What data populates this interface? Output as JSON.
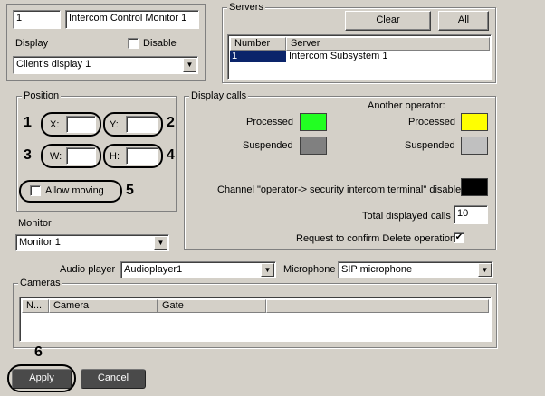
{
  "object": {
    "id": "1",
    "name": "Intercom Control Monitor 1",
    "display_label": "Display",
    "disable_label": "Disable",
    "disable_checked": false,
    "display_value": "Client's display 1"
  },
  "servers": {
    "title": "Servers",
    "clear_label": "Clear",
    "all_label": "All",
    "columns": [
      "Number",
      "Server"
    ],
    "rows": [
      {
        "number": "1",
        "server": "Intercom Subsystem 1"
      }
    ]
  },
  "position": {
    "title": "Position",
    "x_label": "X:",
    "y_label": "Y:",
    "w_label": "W:",
    "h_label": "H:",
    "x_value": "",
    "y_value": "",
    "w_value": "",
    "h_value": "",
    "allow_moving_label": "Allow moving",
    "allow_moving_checked": false
  },
  "annotations": {
    "n1": "1",
    "n2": "2",
    "n3": "3",
    "n4": "4",
    "n5": "5",
    "n6": "6"
  },
  "monitor": {
    "label": "Monitor",
    "value": "Monitor 1"
  },
  "display_calls": {
    "title": "Display calls",
    "another_operator_label": "Another operator:",
    "processed_label": "Processed",
    "suspended_label": "Suspended",
    "processed_color": "#22ff22",
    "suspended_color": "#808080",
    "other_processed_label": "Processed",
    "other_suspended_label": "Suspended",
    "other_processed_color": "#ffff00",
    "other_suspended_color": "#c0c0c0",
    "channel_label": "Channel \"operator-> security intercom terminal\" disabled",
    "channel_color": "#000000",
    "total_label": "Total displayed calls",
    "total_value": "10",
    "confirm_delete_label": "Request to confirm Delete operation",
    "confirm_delete_checked": true
  },
  "audio": {
    "player_label": "Audio player",
    "player_value": "Audioplayer1",
    "microphone_label": "Microphone",
    "microphone_value": "SIP microphone"
  },
  "cameras": {
    "title": "Cameras",
    "columns": [
      "N...",
      "Camera",
      "Gate"
    ]
  },
  "footer": {
    "apply_label": "Apply",
    "cancel_label": "Cancel"
  },
  "icons": {
    "dropdown": "chevron-down-icon",
    "checkmark": "checkmark-icon"
  }
}
